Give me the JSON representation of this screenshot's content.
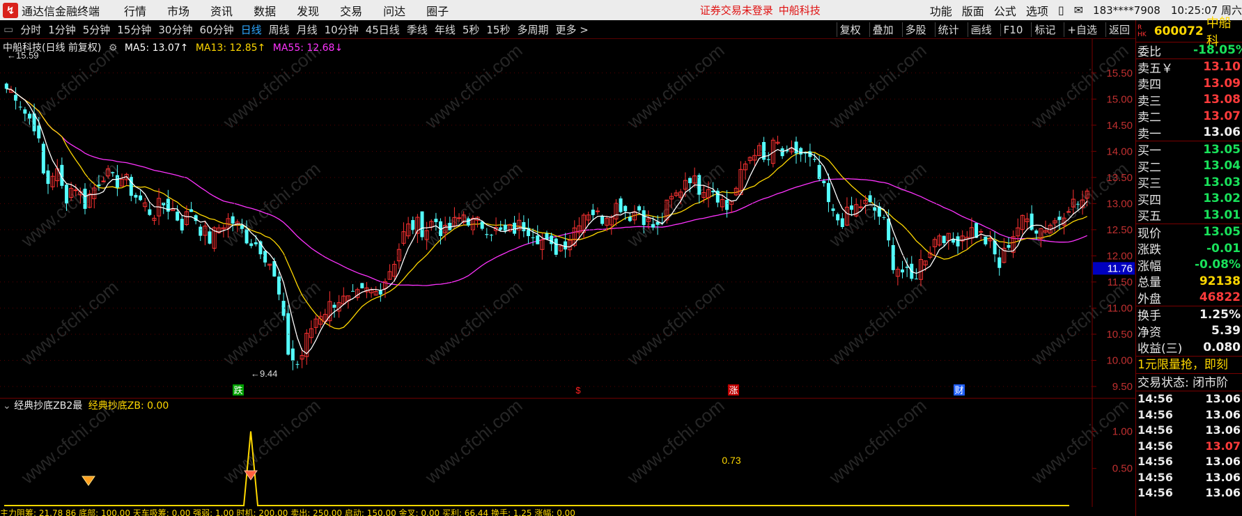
{
  "app": {
    "title": "通达信金融终端",
    "notice": "证券交易未登录",
    "stock_notice": "中船科技"
  },
  "menu": [
    "行情",
    "市场",
    "资讯",
    "数据",
    "发现",
    "交易",
    "问达",
    "圈子"
  ],
  "right_menu": [
    "功能",
    "版面",
    "公式",
    "选项"
  ],
  "user": "183****7908",
  "clock": "10:25:07 周六",
  "periods": [
    "分时",
    "1分钟",
    "5分钟",
    "15分钟",
    "30分钟",
    "60分钟",
    "日线",
    "周线",
    "月线",
    "10分钟",
    "45日线",
    "季线",
    "年线",
    "5秒",
    "15秒",
    "多周期",
    "更多 >"
  ],
  "active_period": "日线",
  "tools": [
    "复权",
    "叠加",
    "多股",
    "统计",
    "画线",
    "F10",
    "标记",
    "+自选",
    "返回"
  ],
  "chart_info": {
    "name": "中船科技(日线 前复权)",
    "ma5": "MA5: 13.07↑",
    "ma13": "MA13: 12.85↑",
    "ma55": "MA55: 12.68↓"
  },
  "y_axis": [
    "15.50",
    "15.00",
    "14.50",
    "14.00",
    "13.50",
    "13.00",
    "12.50",
    "12.00",
    "11.50",
    "11.00",
    "10.50",
    "10.00",
    "9.50"
  ],
  "price_marker": "11.76",
  "high_label": "15.59",
  "low_label": "9.44",
  "event_markers": [
    {
      "text": "跌",
      "color": "#00a000"
    },
    {
      "text": "$",
      "color": "#ff2020"
    },
    {
      "text": "涨",
      "color": "#c00000"
    },
    {
      "text": "财",
      "color": "#2060ff"
    }
  ],
  "indicator": {
    "name": "经典抄底ZB2最",
    "value_label": "经典抄底ZB: 0.00",
    "peak_value": "0.73",
    "y_axis": [
      "1.00",
      "0.50"
    ]
  },
  "bottom_strip": "主力阻筹: 21.78 86   底部: 100.00   天车吸筹: 0.00   强弱: 1.00   时机: 200.00   卖出: 250.00   启动: 150.00   金叉: 0.00   买利: 66.44   换手: 1.25   涨幅: 0.00",
  "watermark": "www.cfchi.com",
  "quote": {
    "tag": "R\nHK",
    "code": "600072",
    "name": "中船科",
    "weibi": {
      "label": "委比",
      "value": "-18.05%"
    },
    "asks": [
      {
        "label": "卖五￥",
        "value": "13.10"
      },
      {
        "label": "卖四",
        "value": "13.09"
      },
      {
        "label": "卖三",
        "value": "13.08"
      },
      {
        "label": "卖二",
        "value": "13.07"
      },
      {
        "label": "卖一",
        "value": "13.06"
      }
    ],
    "bids": [
      {
        "label": "买一",
        "value": "13.05"
      },
      {
        "label": "买二",
        "value": "13.04"
      },
      {
        "label": "买三",
        "value": "13.03"
      },
      {
        "label": "买四",
        "value": "13.02"
      },
      {
        "label": "买五",
        "value": "13.01"
      }
    ],
    "stats1": [
      {
        "label": "现价",
        "value": "13.05"
      },
      {
        "label": "涨跌",
        "value": "-0.01"
      },
      {
        "label": "涨幅",
        "value": "-0.08%"
      },
      {
        "label": "总量",
        "value": "92138"
      },
      {
        "label": "外盘",
        "value": "46822"
      }
    ],
    "stats2": [
      {
        "label": "换手",
        "value": "1.25%"
      },
      {
        "label": "净资",
        "value": "5.39"
      },
      {
        "label": "收益(三)",
        "value": "0.080"
      }
    ],
    "promo": "1元限量抢，即刻",
    "trade_state": "交易状态: 闭市阶",
    "ticks": [
      {
        "time": "14:56",
        "price": "13.06"
      },
      {
        "time": "14:56",
        "price": "13.06"
      },
      {
        "time": "14:56",
        "price": "13.06"
      },
      {
        "time": "14:56",
        "price": "13.07"
      },
      {
        "time": "14:56",
        "price": "13.06"
      },
      {
        "time": "14:56",
        "price": "13.06"
      },
      {
        "time": "14:56",
        "price": "13.06"
      }
    ]
  },
  "chart_data": {
    "type": "candlestick",
    "ylim": [
      9.3,
      15.75
    ],
    "ma_labels": [
      "MA5",
      "MA13",
      "MA55"
    ],
    "close_anchors": [
      15.2,
      15.1,
      14.7,
      14.5,
      13.3,
      13.7,
      13.1,
      13.4,
      13.0,
      13.3,
      13.6,
      13.4,
      13.5,
      13.2,
      13.0,
      12.8,
      13.0,
      12.9,
      12.6,
      12.9,
      12.5,
      12.3,
      12.6,
      12.7,
      12.5,
      12.3,
      12.2,
      11.9,
      11.2,
      10.1,
      9.9,
      10.5,
      10.9,
      11.0,
      11.2,
      11.1,
      11.2,
      11.3,
      11.3,
      11.6,
      12.0,
      12.5,
      12.6,
      12.5,
      12.7,
      12.4,
      12.6,
      12.8,
      12.6,
      12.6,
      12.5,
      12.4,
      12.5,
      12.6,
      12.5,
      12.3,
      12.1,
      12.2,
      12.4,
      12.8,
      12.9,
      12.7,
      12.9,
      13.0,
      12.8,
      12.9,
      12.6,
      12.5,
      13.0,
      13.2,
      13.6,
      13.3,
      13.4,
      13.2,
      12.9,
      13.3,
      13.8,
      14.1,
      13.7,
      14.2,
      13.8,
      14.0,
      13.9,
      13.7,
      13.2,
      12.7,
      12.7,
      12.9,
      13.0,
      12.9,
      12.7,
      11.9,
      11.7,
      11.5,
      11.9,
      12.2,
      12.5,
      12.2,
      12.4,
      12.5,
      12.4,
      12.2,
      11.8,
      12.3,
      12.6,
      12.7,
      12.5,
      12.6,
      12.7,
      13.0,
      13.0,
      13.1
    ]
  }
}
